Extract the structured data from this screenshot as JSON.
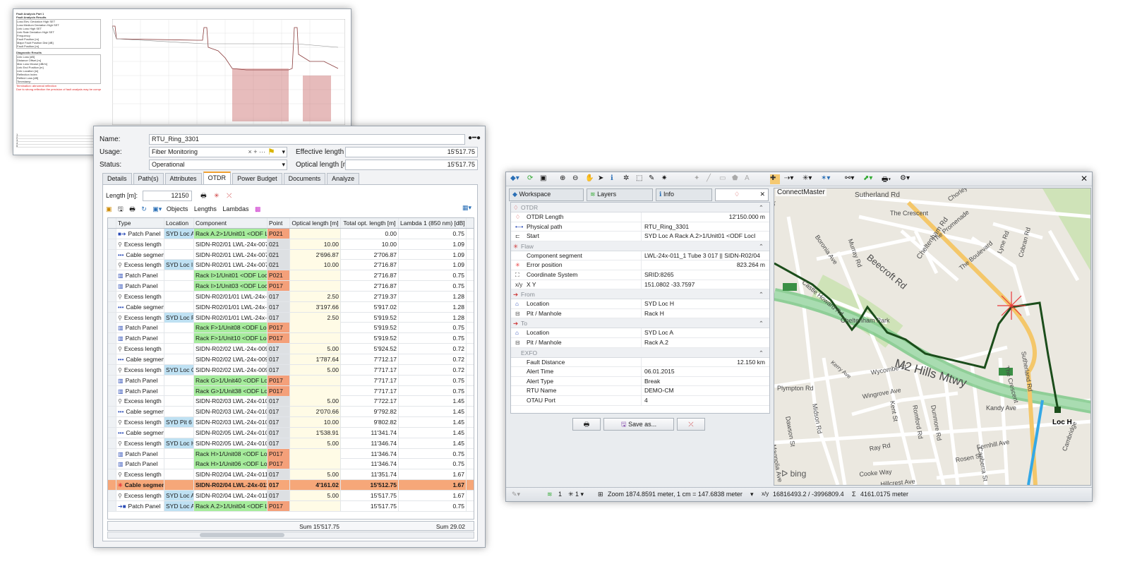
{
  "report": {
    "header_lines": [
      "Fault Analysis Part 1",
      "Fault Analysis Results"
    ],
    "results": [
      "Loss Elev. Deviation High SET",
      "Loss Medium Deviation High SET",
      "Link Loss High SET",
      "Link Rate Deviation High SET",
      "Frequency",
      "Fault Position [m]",
      "Major Fault Position Dist [dB]",
      "Fault Position [m]"
    ],
    "section2": "Diagnostic Results",
    "diag": [
      "Link Loss [dB]",
      "Distance Offset [m]",
      "Max Loss Mouse [dB/m]",
      "Link End Position [m]",
      "Link Location [m]",
      "Reflection Index",
      "Reflect Loss [dB]",
      "Timestamp"
    ],
    "red_lines": [
      "Termination: abnormal reflection",
      "Due to strong reflection the precision of fault analysis may be compromised"
    ],
    "bottom_rows": [
      "1",
      "2",
      "3",
      "4",
      "5"
    ]
  },
  "rtu": {
    "name_label": "Name:",
    "name_value": "RTU_Ring_3301",
    "usage_label": "Usage:",
    "usage_value": "Fiber Monitoring",
    "status_label": "Status:",
    "status_value": "Operational",
    "eff_label": "Effective length [m]:",
    "eff_value": "15'517.75",
    "opt_label": "Optical length [m]:",
    "opt_value": "15'517.75",
    "usage_controls": "×  +  ···",
    "tabs": [
      "Details",
      "Path(s)",
      "Attributes",
      "OTDR",
      "Power Budget",
      "Documents",
      "Analyze"
    ],
    "active_tab": "OTDR",
    "length_label": "Length [m]:",
    "length_value": "12150",
    "toolbar2": [
      "Objects",
      "Lengths",
      "Lambdas"
    ],
    "columns": [
      "Type",
      "Location",
      "Component",
      "Point",
      "Optical length [m]",
      "Total opt. length [m]",
      "Lambda 1 (850 nm) [dB]"
    ],
    "rows": [
      {
        "icon": "start",
        "type": "Patch Panel",
        "loc": "SYD Loc A",
        "comp": "Rack A.2>1/Unit01 <ODF LocI",
        "pt": "P021",
        "opt": "",
        "tot": "0.00",
        "lam": "0.75",
        "locc": "blue",
        "compc": "green",
        "ptc": "orange"
      },
      {
        "icon": "excess",
        "type": "Excess length",
        "loc": "",
        "comp": "SIDN-R02/01 LWL-24x-007",
        "pt": "021",
        "opt": "10.00",
        "tot": "10.00",
        "lam": "1.09",
        "locc": "",
        "compc": "",
        "ptc": "grey"
      },
      {
        "icon": "cable",
        "type": "Cable segment",
        "loc": "",
        "comp": "SIDN-R02/01 LWL-24x-007",
        "pt": "021",
        "opt": "2'696.87",
        "tot": "2'706.87",
        "lam": "1.09",
        "locc": "",
        "compc": "",
        "ptc": "grey"
      },
      {
        "icon": "excess",
        "type": "Excess length",
        "loc": "SYD Loc I",
        "comp": "SIDN-R02/01 LWL-24x-007",
        "pt": "021",
        "opt": "10.00",
        "tot": "2'716.87",
        "lam": "1.09",
        "locc": "blue",
        "compc": "",
        "ptc": "grey"
      },
      {
        "icon": "patch",
        "type": "Patch Panel",
        "loc": "",
        "comp": "Rack I>1/Unit01 <ODF LocA",
        "pt": "P021",
        "opt": "",
        "tot": "2'716.87",
        "lam": "0.75",
        "locc": "",
        "compc": "green",
        "ptc": "orange"
      },
      {
        "icon": "patch",
        "type": "Patch Panel",
        "loc": "",
        "comp": "Rack I>1/Unit03 <ODF LocF",
        "pt": "P017",
        "opt": "",
        "tot": "2'716.87",
        "lam": "0.75",
        "locc": "",
        "compc": "green",
        "ptc": "orange"
      },
      {
        "icon": "excess",
        "type": "Excess length",
        "loc": "",
        "comp": "SIDN-R02/01/01 LWL-24x-008",
        "pt": "017",
        "opt": "2.50",
        "tot": "2'719.37",
        "lam": "1.28",
        "locc": "",
        "compc": "",
        "ptc": "grey"
      },
      {
        "icon": "cable",
        "type": "Cable segment",
        "loc": "",
        "comp": "SIDN-R02/01/01 LWL-24x-008",
        "pt": "017",
        "opt": "3'197.66",
        "tot": "5'917.02",
        "lam": "1.28",
        "locc": "",
        "compc": "",
        "ptc": "grey"
      },
      {
        "icon": "excess",
        "type": "Excess length",
        "loc": "SYD Loc F",
        "comp": "SIDN-R02/01/01 LWL-24x-008",
        "pt": "017",
        "opt": "2.50",
        "tot": "5'919.52",
        "lam": "1.28",
        "locc": "blue",
        "compc": "",
        "ptc": "grey"
      },
      {
        "icon": "patch",
        "type": "Patch Panel",
        "loc": "",
        "comp": "Rack F>1/Unit08 <ODF LocI",
        "pt": "P017",
        "opt": "",
        "tot": "5'919.52",
        "lam": "0.75",
        "locc": "",
        "compc": "green",
        "ptc": "orange"
      },
      {
        "icon": "patch",
        "type": "Patch Panel",
        "loc": "",
        "comp": "Rack F>1/Unit10 <ODF LocG",
        "pt": "P017",
        "opt": "",
        "tot": "5'919.52",
        "lam": "0.75",
        "locc": "",
        "compc": "green",
        "ptc": "orange"
      },
      {
        "icon": "excess",
        "type": "Excess length",
        "loc": "",
        "comp": "SIDN-R02/02 LWL-24x-009",
        "pt": "017",
        "opt": "5.00",
        "tot": "5'924.52",
        "lam": "0.72",
        "locc": "",
        "compc": "",
        "ptc": "grey"
      },
      {
        "icon": "cable",
        "type": "Cable segment",
        "loc": "",
        "comp": "SIDN-R02/02 LWL-24x-009",
        "pt": "017",
        "opt": "1'787.64",
        "tot": "7'712.17",
        "lam": "0.72",
        "locc": "",
        "compc": "",
        "ptc": "grey"
      },
      {
        "icon": "excess",
        "type": "Excess length",
        "loc": "SYD Loc G",
        "comp": "SIDN-R02/02 LWL-24x-009",
        "pt": "017",
        "opt": "5.00",
        "tot": "7'717.17",
        "lam": "0.72",
        "locc": "blue",
        "compc": "",
        "ptc": "grey"
      },
      {
        "icon": "patch",
        "type": "Patch Panel",
        "loc": "",
        "comp": "Rack G>1/Unit40 <ODF LocF",
        "pt": "P017",
        "opt": "",
        "tot": "7'717.17",
        "lam": "0.75",
        "locc": "",
        "compc": "green",
        "ptc": "orange"
      },
      {
        "icon": "patch",
        "type": "Patch Panel",
        "loc": "",
        "comp": "Rack G>1/Unit38 <ODF LocH",
        "pt": "P017",
        "opt": "",
        "tot": "7'717.17",
        "lam": "0.75",
        "locc": "",
        "compc": "green",
        "ptc": "orange"
      },
      {
        "icon": "excess",
        "type": "Excess length",
        "loc": "",
        "comp": "SIDN-R02/03 LWL-24x-010",
        "pt": "017",
        "opt": "5.00",
        "tot": "7'722.17",
        "lam": "1.45",
        "locc": "",
        "compc": "",
        "ptc": "grey"
      },
      {
        "icon": "cable",
        "type": "Cable segment",
        "loc": "",
        "comp": "SIDN-R02/03 LWL-24x-010",
        "pt": "017",
        "opt": "2'070.66",
        "tot": "9'792.82",
        "lam": "1.45",
        "locc": "",
        "compc": "",
        "ptc": "grey"
      },
      {
        "icon": "excess",
        "type": "Excess length",
        "loc": "SYD Pit 6",
        "comp": "SIDN-R02/03 LWL-24x-010",
        "pt": "017",
        "opt": "10.00",
        "tot": "9'802.82",
        "lam": "1.45",
        "locc": "blue",
        "compc": "",
        "ptc": "grey"
      },
      {
        "icon": "cable",
        "type": "Cable segment",
        "loc": "",
        "comp": "SIDN-R02/05 LWL-24x-010",
        "pt": "017",
        "opt": "1'538.91",
        "tot": "11'341.74",
        "lam": "1.45",
        "locc": "",
        "compc": "",
        "ptc": "grey"
      },
      {
        "icon": "excess",
        "type": "Excess length",
        "loc": "SYD Loc H",
        "comp": "SIDN-R02/05 LWL-24x-010",
        "pt": "017",
        "opt": "5.00",
        "tot": "11'346.74",
        "lam": "1.45",
        "locc": "blue",
        "compc": "",
        "ptc": "grey"
      },
      {
        "icon": "patch",
        "type": "Patch Panel",
        "loc": "",
        "comp": "Rack H>1/Unit08 <ODF LocG",
        "pt": "P017",
        "opt": "",
        "tot": "11'346.74",
        "lam": "0.75",
        "locc": "",
        "compc": "green",
        "ptc": "orange"
      },
      {
        "icon": "patch",
        "type": "Patch Panel",
        "loc": "",
        "comp": "Rack H>1/Unit06 <ODF LocA",
        "pt": "P017",
        "opt": "",
        "tot": "11'346.74",
        "lam": "0.75",
        "locc": "",
        "compc": "green",
        "ptc": "orange"
      },
      {
        "icon": "excess",
        "type": "Excess length",
        "loc": "",
        "comp": "SIDN-R02/04 LWL-24x-011",
        "pt": "017",
        "opt": "5.00",
        "tot": "11'351.74",
        "lam": "1.67",
        "locc": "",
        "compc": "",
        "ptc": "grey"
      },
      {
        "icon": "flaw",
        "type": "Cable segment",
        "loc": "",
        "comp": "SIDN-R02/04 LWL-24x-011",
        "pt": "017",
        "opt": "4'161.02",
        "tot": "15'512.75",
        "lam": "1.67",
        "locc": "",
        "compc": "",
        "ptc": "",
        "hl": true
      },
      {
        "icon": "excess",
        "type": "Excess length",
        "loc": "SYD Loc A",
        "comp": "SIDN-R02/04 LWL-24x-011",
        "pt": "017",
        "opt": "5.00",
        "tot": "15'517.75",
        "lam": "1.67",
        "locc": "blue",
        "compc": "",
        "ptc": "grey"
      },
      {
        "icon": "end",
        "type": "Patch Panel",
        "loc": "SYD Loc A",
        "comp": "Rack A.2>1/Unit04 <ODF LocH",
        "pt": "P017",
        "opt": "",
        "tot": "15'517.75",
        "lam": "0.75",
        "locc": "blue",
        "compc": "green",
        "ptc": "orange"
      }
    ],
    "sum_opt": "Sum 15'517.75",
    "sum_lam": "Sum 29.02"
  },
  "map_window": {
    "tabs": [
      "Workspace",
      "Layers",
      "Info"
    ],
    "sections": [
      {
        "title": "OTDR",
        "rows": [
          {
            "k": "OTDR Length",
            "v": "12'150.000 m",
            "right": true,
            "icon": "otdr"
          },
          {
            "k": "Physical path",
            "v": "RTU_Ring_3301",
            "icon": "path"
          },
          {
            "k": "Start",
            "v": "SYD Loc A Rack A.2>1/Unit01 <ODF LocI P021",
            "icon": "start"
          }
        ]
      },
      {
        "title": "Flaw",
        "rows": [
          {
            "k": "Component segment",
            "v": "LWL-24x-011_1 Tube 3 017 || SIDN-R02/04"
          },
          {
            "k": "Error position",
            "v": "823.264 m",
            "right": true,
            "icon": "flaw"
          },
          {
            "k": "Coordinate System",
            "v": "SRID:8265",
            "icon": "coord"
          },
          {
            "k": "X                                    Y",
            "v": "151.0802              -33.7597",
            "icon": "xy"
          }
        ]
      },
      {
        "title": "From",
        "rows": [
          {
            "k": "Location",
            "v": "SYD Loc H",
            "icon": "house"
          },
          {
            "k": "Pit / Manhole",
            "v": "Rack H",
            "icon": "pit"
          }
        ]
      },
      {
        "title": "To",
        "rows": [
          {
            "k": "Location",
            "v": "SYD Loc A",
            "icon": "house"
          },
          {
            "k": "Pit / Manhole",
            "v": "Rack A.2",
            "icon": "pit"
          }
        ]
      },
      {
        "title": "EXFO",
        "rows": [
          {
            "k": "Fault Distance",
            "v": "12.150 km",
            "right": true
          },
          {
            "k": "Alert Time",
            "v": "06.01.2015"
          },
          {
            "k": "Alert Type",
            "v": "Break"
          },
          {
            "k": "RTU Name",
            "v": "DEMO-CM"
          },
          {
            "k": "OTAU Port",
            "v": "4"
          }
        ]
      }
    ],
    "save_label": "Save as...",
    "map_title": "ConnectMaster",
    "bing": "bing",
    "streets": [
      "Sutherland Rd",
      "The Crescent",
      "Chorley",
      "Kirkham St",
      "Boronia Ave",
      "Murray Rd",
      "The Promenade",
      "Beecroft Rd",
      "Cheltenham Rd",
      "The Boulevard",
      "Lyne Rd",
      "Cobran Rd",
      "Castle Howard Rd",
      "Cheltenham Park",
      "M2 Hills Mtwy",
      "Kerry Ave",
      "Wycombe St",
      "Plympton Rd",
      "Midson Rd",
      "Dawson St",
      "Kent St",
      "Romford Rd",
      "Dunmore Rd",
      "Wingrove Ave",
      "Magnolia Ave",
      "Kandy Ave",
      "Canberra St",
      "Ray Rd",
      "Fernhill Ave",
      "Cooke Way",
      "Rosen St",
      "Hillcrest Ave",
      "Loc H",
      "The Crescent",
      "Sutherland Rd",
      "Cambridge"
    ],
    "status": {
      "one": "1",
      "zoom": "Zoom 1874.8591 meter, 1 cm = 147.6838 meter",
      "xy": "16816493.2 / -3996809.4",
      "sum": "4161.0175 meter"
    }
  },
  "colors": {
    "accent": "#f0a030",
    "fault": "#e8393b",
    "route": "#1b4d1b",
    "motorway": "#7fc98a"
  }
}
